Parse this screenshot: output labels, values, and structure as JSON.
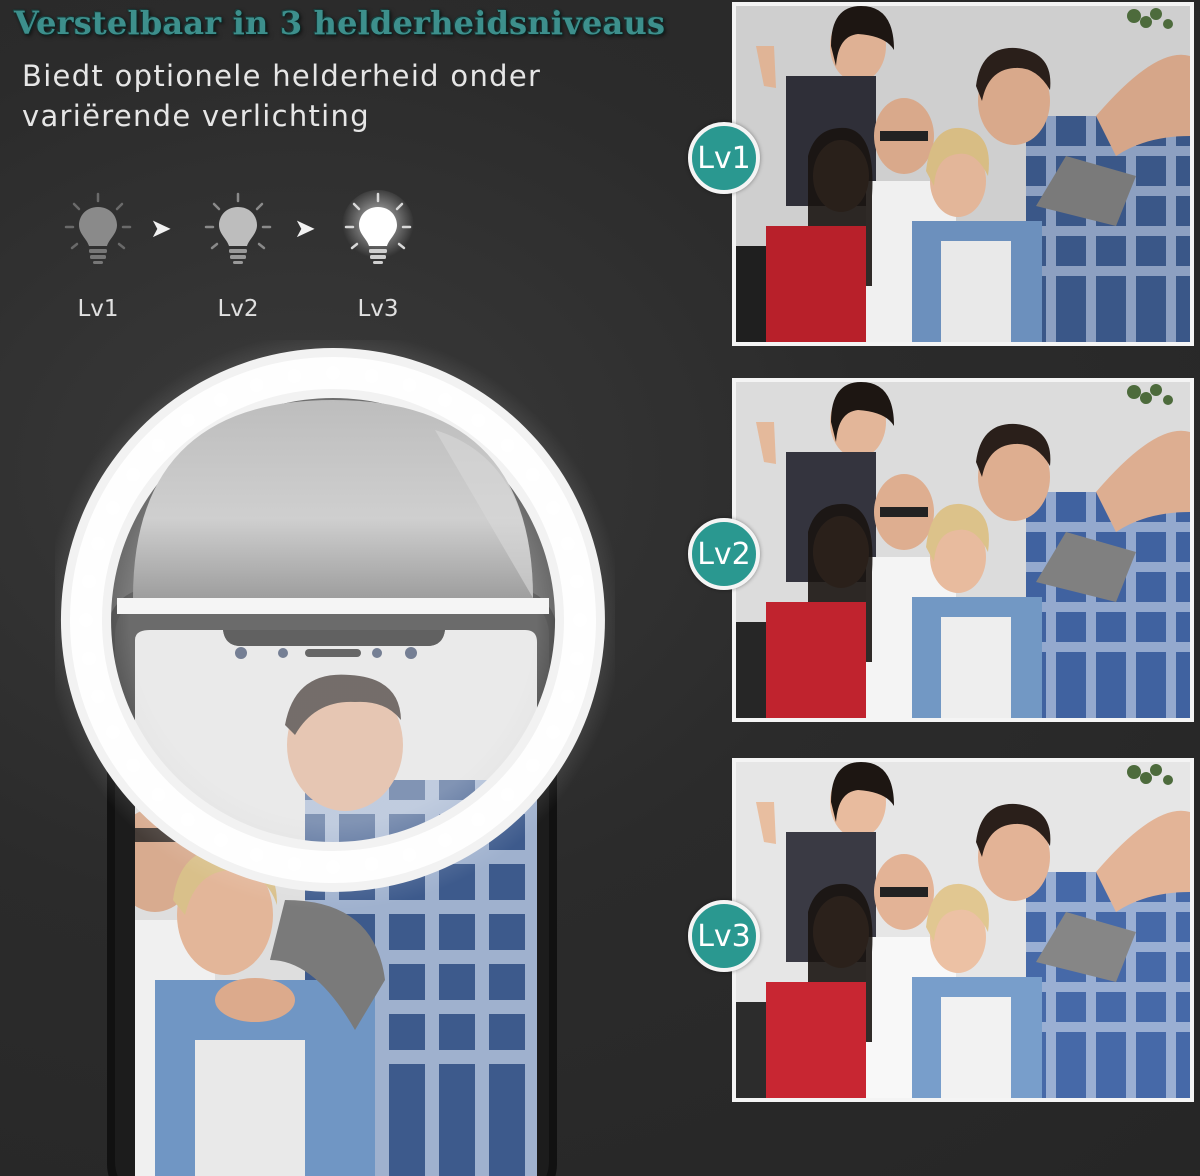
{
  "header": {
    "title": "Verstelbaar in 3 helderheidsniveaus",
    "subtitle": "Biedt optionele helderheid onder variërende verlichting"
  },
  "levels": [
    {
      "label": "Lv1",
      "icon": "dim-bulb-icon",
      "brightness": 1
    },
    {
      "label": "Lv2",
      "icon": "medium-bulb-icon",
      "brightness": 2
    },
    {
      "label": "Lv3",
      "icon": "bright-bulb-icon",
      "brightness": 3
    }
  ],
  "level_arrow": "➤",
  "examples": [
    {
      "badge": "Lv1"
    },
    {
      "badge": "Lv2"
    },
    {
      "badge": "Lv3"
    }
  ],
  "colors": {
    "background": "#2a2a2a",
    "title": "#3d8f8c",
    "badge": "#2a9890",
    "subtitle_text": "#e6e6e6"
  }
}
